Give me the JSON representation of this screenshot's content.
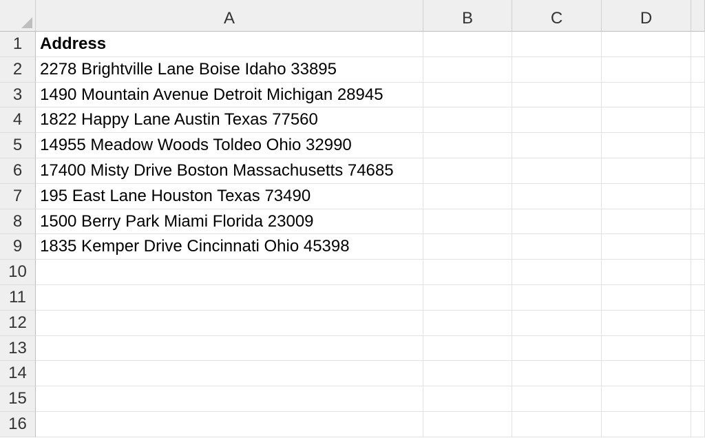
{
  "columns": [
    "A",
    "B",
    "C",
    "D"
  ],
  "rows": [
    {
      "num": "1",
      "a": "Address",
      "bold": true
    },
    {
      "num": "2",
      "a": "2278 Brightville Lane Boise Idaho 33895"
    },
    {
      "num": "3",
      "a": "1490 Mountain Avenue Detroit Michigan 28945"
    },
    {
      "num": "4",
      "a": "1822 Happy Lane Austin Texas 77560"
    },
    {
      "num": "5",
      "a": "14955 Meadow Woods Toldeo Ohio 32990"
    },
    {
      "num": "6",
      "a": "17400 Misty Drive Boston Massachusetts 74685"
    },
    {
      "num": "7",
      "a": "195 East Lane Houston Texas 73490"
    },
    {
      "num": "8",
      "a": "1500 Berry Park Miami Florida 23009"
    },
    {
      "num": "9",
      "a": "1835 Kemper Drive Cincinnati Ohio 45398"
    },
    {
      "num": "10",
      "a": ""
    },
    {
      "num": "11",
      "a": ""
    },
    {
      "num": "12",
      "a": ""
    },
    {
      "num": "13",
      "a": ""
    },
    {
      "num": "14",
      "a": ""
    },
    {
      "num": "15",
      "a": ""
    },
    {
      "num": "16",
      "a": ""
    }
  ]
}
